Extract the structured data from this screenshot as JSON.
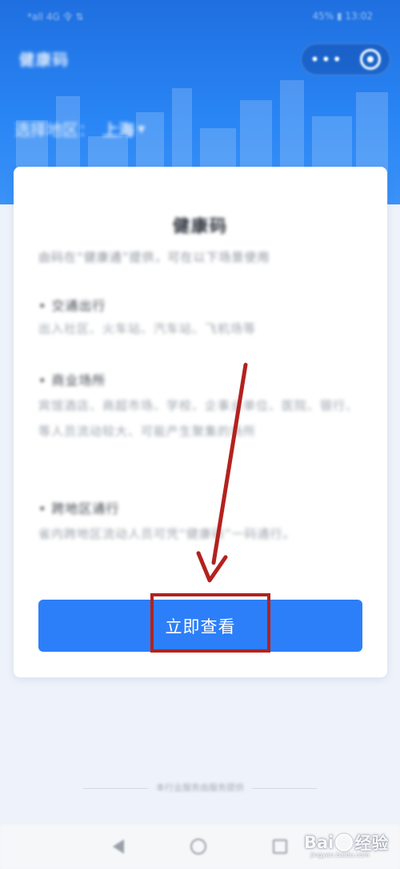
{
  "status_bar": {
    "left": "*all 4G 令 ⇅",
    "right": "45% ▮ 13:02"
  },
  "header": {
    "title": "健康码",
    "region_label": "选择地区：",
    "region_value": "上海"
  },
  "card": {
    "title": "健康码",
    "description": "由码在“健康通”提供，可在以下场景使用",
    "sections": [
      {
        "title": "• 交通出行",
        "text": "出入社区、火车站、汽车站、飞机场等"
      },
      {
        "title": "• 商业场所",
        "text": "宾馆酒店、商超市场、学校、企事业单位、医院、银行、等人员流动较大、可能产生聚集的场所"
      },
      {
        "title": "• 跨地区通行",
        "text": "省内跨地区流动人员可凭“健康码”一码通行。"
      }
    ],
    "button_label": "立即查看"
  },
  "footer": {
    "text": "本行业服务由服务提供"
  },
  "watermark": {
    "brand_left": "Bai",
    "brand_right": "经验",
    "url": "jingyan.baidu.com"
  },
  "colors": {
    "header_blue": "#2a86f5",
    "button_blue": "#2d7ff9",
    "annotation_red": "#b3221e"
  }
}
